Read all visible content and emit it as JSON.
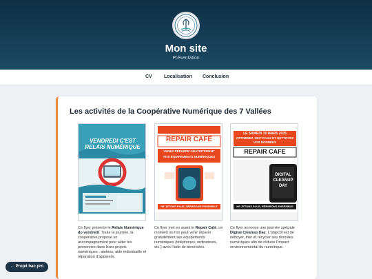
{
  "header": {
    "logo_icon": "cooperative-tree-logo",
    "title": "Mon site",
    "subtitle": "Présentation"
  },
  "nav": {
    "items": [
      "CV",
      "Localisation",
      "Conclusion"
    ]
  },
  "main": {
    "section_title": "Les activités de la Coopérative Numérique des 7 Vallées",
    "accent_color": "#f08a3c",
    "flyers": [
      {
        "poster_title_1": "VENDREDI C'EST",
        "poster_title_2": "RELAIS NUMÉRIQUE",
        "colors": [
          "#3aa0b8",
          "#e8f2f5"
        ],
        "caption_pre": "Ce flyer présente le ",
        "caption_bold": "Relais Numérique du vendredi",
        "caption_post": ". Toute la journée, la coopérative propose un accompagnement pour aider les personnes dans leurs projets numériques : ateliers, aide individuelle et réparation d'appareils."
      },
      {
        "poster_title_1": "REPAIR CAFÉ",
        "poster_title_2": "VENEZ RÉPARER GRATUITEMENT",
        "poster_title_3": "VOS ÉQUIPEMENTS NUMÉRIQUES",
        "poster_footer": "NE JETONS PLUS, RÉPARONS ENSEMBLE",
        "colors": [
          "#e8461c",
          "#fbe3d6"
        ],
        "caption_pre": "Ce flyer met en avant le ",
        "caption_bold": "Repair Café",
        "caption_post": ", un moment où l'on peut venir réparer gratuitement ses équipements numériques (téléphones, ordinateurs, etc.) avec l'aide de bénévoles."
      },
      {
        "poster_title_1": "LE SAMEDI 15 MARS 2025",
        "poster_title_2": "OPTIMISEZ, RECYCLEZ ET NETTOYEZ VOS DONNÉES",
        "poster_title_3": "REPAIR CAFE",
        "poster_title_4": "DIGITAL CLEANUP DAY",
        "poster_footer": "NE JETONS PLUS, RÉPARONS ENSEMBLE",
        "colors": [
          "#1a1a1a",
          "#e8461c"
        ],
        "caption_pre": "Ce flyer annonce une journée spéciale ",
        "caption_bold": "Digital Cleanup Day",
        "caption_post": ". L'objectif est de nettoyer, trier et recycler ses données numériques afin de réduire l'impact environnemental du numérique."
      }
    ]
  },
  "back_button": {
    "label": "← Projet bac pro"
  }
}
